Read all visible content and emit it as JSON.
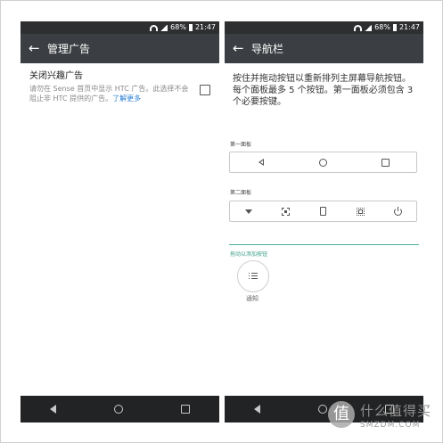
{
  "status_bar": {
    "battery": "68%",
    "time": "21:47"
  },
  "left_screen": {
    "title": "管理广告",
    "setting": {
      "title": "关闭兴趣广告",
      "description": "请勿在 Sense 首页中显示 HTC 广告。此选择不会阻止非 HTC 提供的广告。",
      "link": "了解更多"
    }
  },
  "right_screen": {
    "title": "导航栏",
    "instructions": "按住并拖动按钮以重新排列主屏幕导航按钮。每个面板最多 5 个按钮。第一面板必须包含 3 个必要按键。",
    "panel1_label": "第一面板",
    "panel2_label": "第二面板",
    "drag_label": "拖动以添加按钮",
    "drag_button_label": "通知"
  },
  "icons": {
    "back": "back-arrow-icon",
    "nav_back": "nav-back-icon",
    "nav_home": "nav-home-icon",
    "nav_recent": "nav-recent-icon"
  },
  "watermark": {
    "text": "什么值得买",
    "sub": "SMZDM.COM",
    "badge": "值"
  },
  "colors": {
    "appbar": "#3b3e42",
    "statusbar": "#2d2f31",
    "navbar": "#222324",
    "link": "#2a7fd4",
    "accent": "#3fa08a"
  }
}
